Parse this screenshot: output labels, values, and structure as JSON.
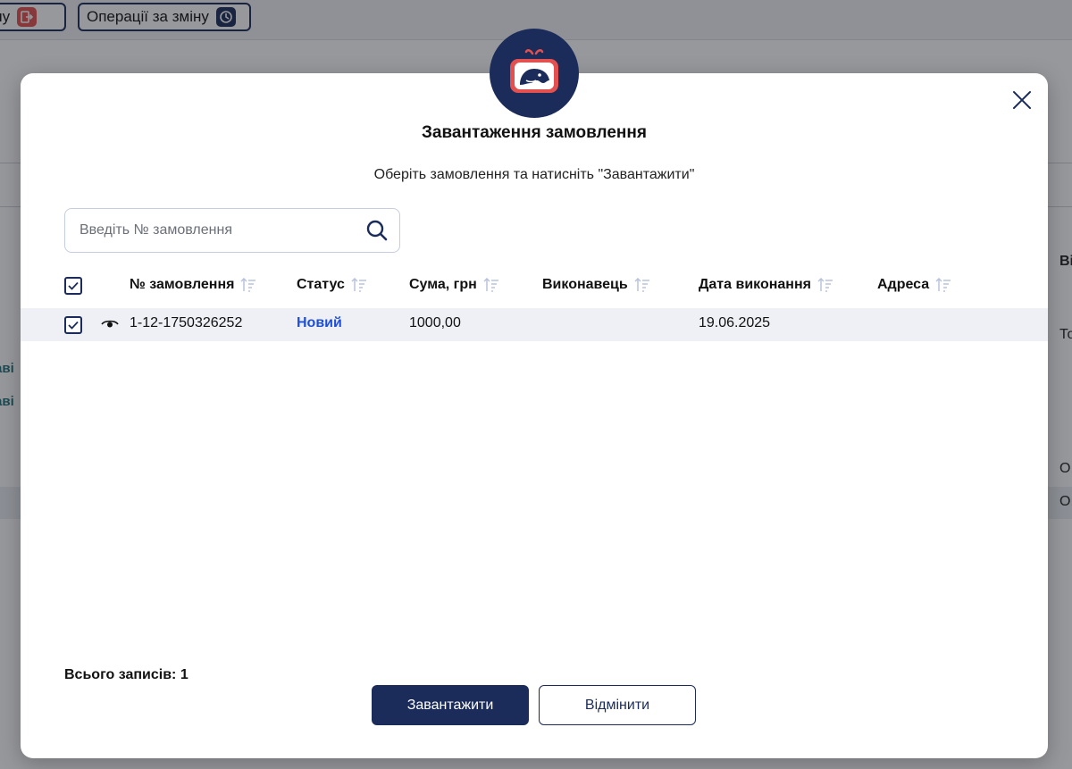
{
  "background": {
    "left_button_label": "зміну",
    "ops_button_label": "Операції за зміну",
    "right_texts": [
      "Ві",
      "То",
      "О.",
      "О."
    ],
    "left_texts": [
      "аві",
      "аві"
    ]
  },
  "modal": {
    "title": "Завантаження замовлення",
    "subtitle": "Оберіть замовлення та натисніть \"Завантажити\"",
    "search": {
      "placeholder": "Введіть № замовлення",
      "value": ""
    },
    "table": {
      "columns": [
        "№ замовлення",
        "Статус",
        "Сума, грн",
        "Виконавець",
        "Дата виконання",
        "Адреса"
      ],
      "rows": [
        {
          "checked": true,
          "order_no": "1-12-1750326252",
          "status": "Новий",
          "sum": "1000,00",
          "performer": "",
          "date": "19.06.2025",
          "address": ""
        }
      ]
    },
    "total_label": "Всього записів: 1",
    "load_button": "Завантажити",
    "cancel_button": "Відмінити"
  },
  "colors": {
    "navy": "#1b2c5a",
    "status_new": "#1f4fd6",
    "logo_red": "#e2504f"
  }
}
